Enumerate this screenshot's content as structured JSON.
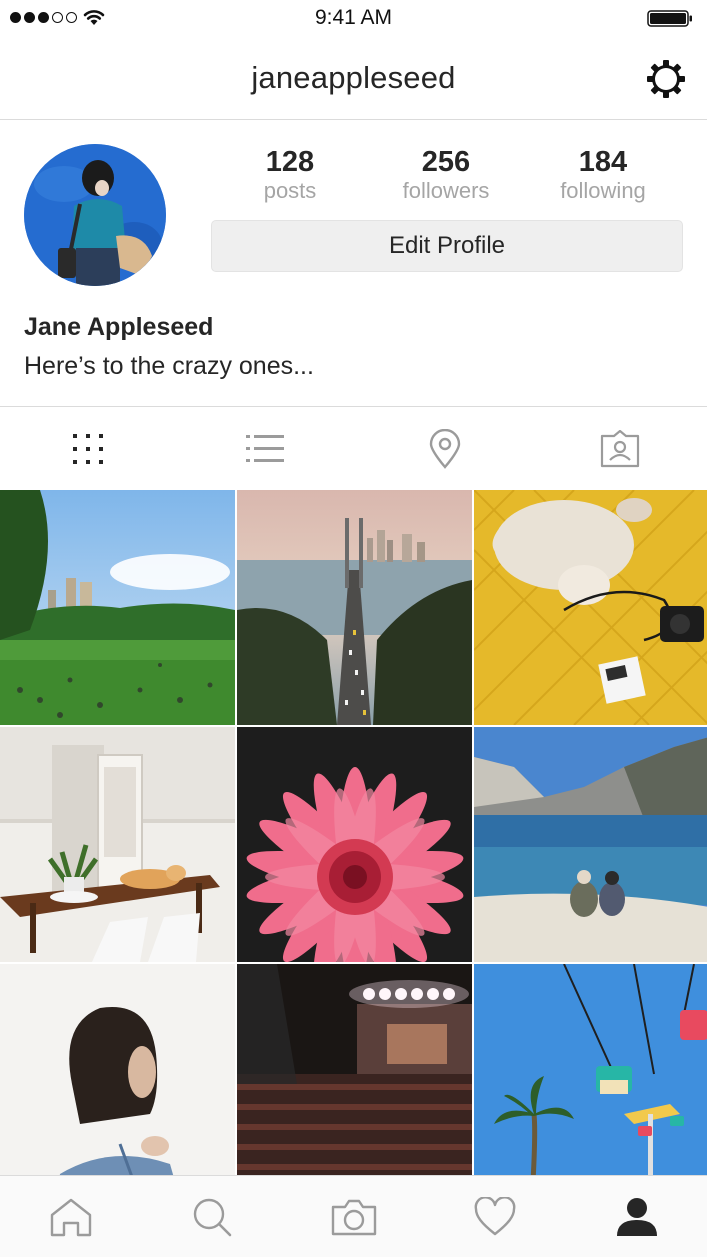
{
  "status_bar": {
    "time": "9:41 AM",
    "signal_bars_filled": 3,
    "signal_bars_total": 5,
    "icons": [
      "signal-dots-icon",
      "wifi-icon",
      "battery-icon"
    ]
  },
  "nav": {
    "title": "janeappleseed",
    "settings_icon": "gear-icon"
  },
  "profile": {
    "stats": {
      "posts": {
        "value": "128",
        "label": "posts"
      },
      "followers": {
        "value": "256",
        "label": "followers"
      },
      "following": {
        "value": "184",
        "label": "following"
      }
    },
    "edit_button_label": "Edit Profile",
    "full_name": "Jane Appleseed",
    "bio": "Here’s to the crazy ones..."
  },
  "view_tabs": [
    {
      "icon": "grid-icon",
      "active": true
    },
    {
      "icon": "list-icon",
      "active": false
    },
    {
      "icon": "location-pin-icon",
      "active": false
    },
    {
      "icon": "tagged-photos-icon",
      "active": false
    }
  ],
  "photos": [
    {
      "subject": "park-lawn-photo"
    },
    {
      "subject": "bay-bridge-photo"
    },
    {
      "subject": "cat-on-yellow-blanket-photo"
    },
    {
      "subject": "dining-room-cat-photo"
    },
    {
      "subject": "pink-gerbera-flower-photo"
    },
    {
      "subject": "mountain-lake-couple-photo"
    },
    {
      "subject": "woman-portrait-photo"
    },
    {
      "subject": "concert-crowd-photo"
    },
    {
      "subject": "amusement-ride-palm-photo"
    }
  ],
  "tab_bar": [
    {
      "icon": "home-icon",
      "active": false
    },
    {
      "icon": "search-icon",
      "active": false
    },
    {
      "icon": "camera-icon",
      "active": false
    },
    {
      "icon": "heart-icon",
      "active": false
    },
    {
      "icon": "profile-icon",
      "active": true
    }
  ],
  "colors": {
    "text": "#262626",
    "secondary_text": "#a5a5a5",
    "divider": "#dbdbdb",
    "button_bg": "#efefef",
    "inactive_icon": "#9b9b9b"
  }
}
